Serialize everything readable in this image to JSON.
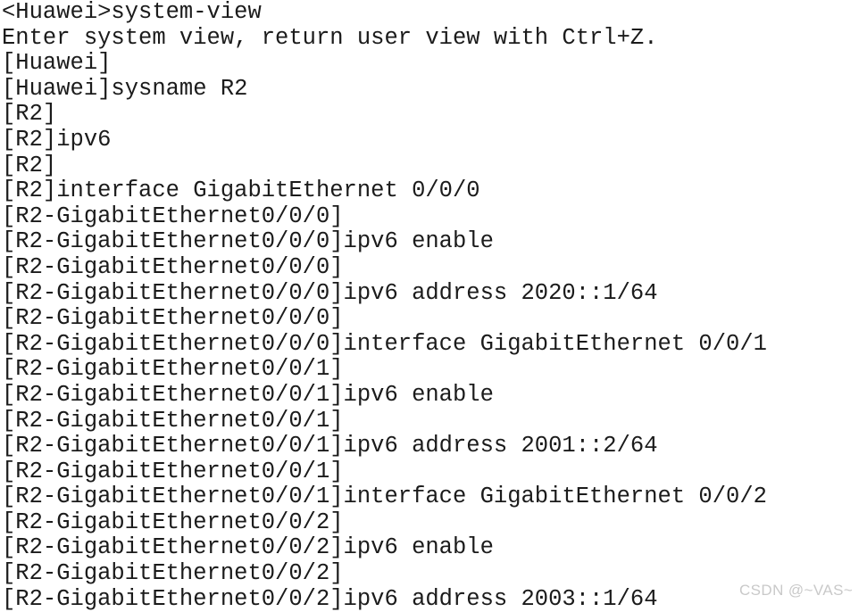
{
  "terminal": {
    "device_prompt_user": "<Huawei>",
    "background_color": "#ffffff",
    "text_color": "#1b1b1b",
    "lines": [
      "<Huawei>system-view",
      "Enter system view, return user view with Ctrl+Z.",
      "[Huawei]",
      "[Huawei]sysname R2",
      "[R2]",
      "[R2]ipv6",
      "[R2]",
      "[R2]interface GigabitEthernet 0/0/0",
      "[R2-GigabitEthernet0/0/0]",
      "[R2-GigabitEthernet0/0/0]ipv6 enable",
      "[R2-GigabitEthernet0/0/0]",
      "[R2-GigabitEthernet0/0/0]ipv6 address 2020::1/64",
      "[R2-GigabitEthernet0/0/0]",
      "[R2-GigabitEthernet0/0/0]interface GigabitEthernet 0/0/1",
      "[R2-GigabitEthernet0/0/1]",
      "[R2-GigabitEthernet0/0/1]ipv6 enable",
      "[R2-GigabitEthernet0/0/1]",
      "[R2-GigabitEthernet0/0/1]ipv6 address 2001::2/64",
      "[R2-GigabitEthernet0/0/1]",
      "[R2-GigabitEthernet0/0/1]interface GigabitEthernet 0/0/2",
      "[R2-GigabitEthernet0/0/2]",
      "[R2-GigabitEthernet0/0/2]ipv6 enable",
      "[R2-GigabitEthernet0/0/2]",
      "[R2-GigabitEthernet0/0/2]ipv6 address 2003::1/64"
    ]
  },
  "watermark": {
    "text": "CSDN @~VAS~",
    "color": "#c9c9c9"
  }
}
